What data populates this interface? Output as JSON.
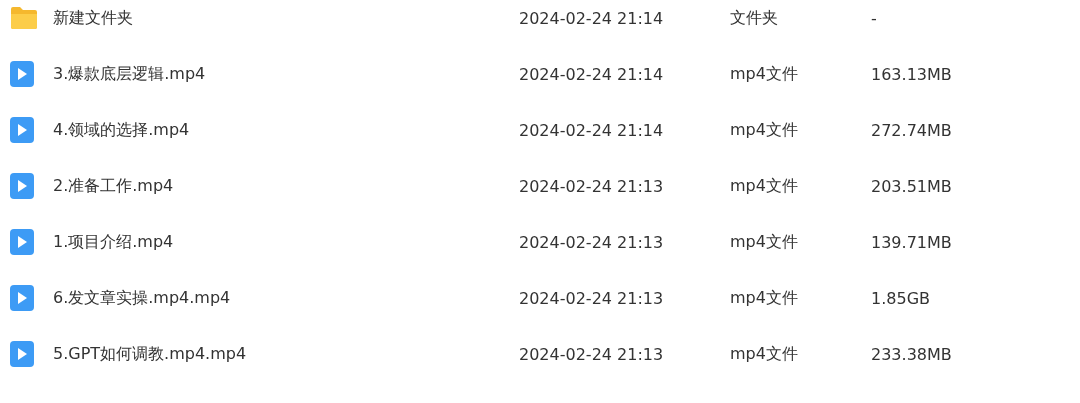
{
  "files": [
    {
      "kind": "folder",
      "name": "新建文件夹",
      "modified": "2024-02-24 21:14",
      "type": "文件夹",
      "size": "-"
    },
    {
      "kind": "video",
      "name": "3.爆款底层逻辑.mp4",
      "modified": "2024-02-24 21:14",
      "type": "mp4文件",
      "size": "163.13MB"
    },
    {
      "kind": "video",
      "name": "4.领域的选择.mp4",
      "modified": "2024-02-24 21:14",
      "type": "mp4文件",
      "size": "272.74MB"
    },
    {
      "kind": "video",
      "name": "2.准备工作.mp4",
      "modified": "2024-02-24 21:13",
      "type": "mp4文件",
      "size": "203.51MB"
    },
    {
      "kind": "video",
      "name": "1.项目介绍.mp4",
      "modified": "2024-02-24 21:13",
      "type": "mp4文件",
      "size": "139.71MB"
    },
    {
      "kind": "video",
      "name": "6.发文章实操.mp4.mp4",
      "modified": "2024-02-24 21:13",
      "type": "mp4文件",
      "size": "1.85GB"
    },
    {
      "kind": "video",
      "name": "5.GPT如何调教.mp4.mp4",
      "modified": "2024-02-24 21:13",
      "type": "mp4文件",
      "size": "233.38MB"
    }
  ]
}
